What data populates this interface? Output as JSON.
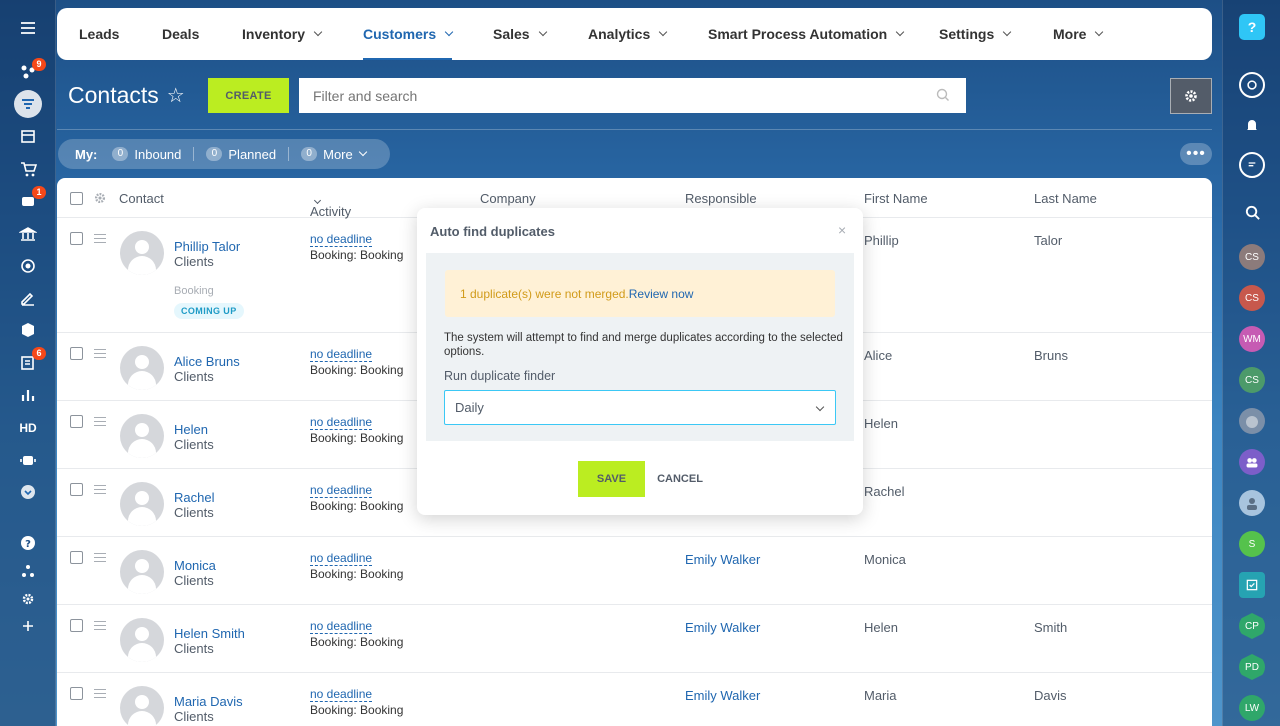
{
  "nav": {
    "items": [
      {
        "label": "Leads",
        "chev": false
      },
      {
        "label": "Deals",
        "chev": false
      },
      {
        "label": "Inventory",
        "chev": true
      },
      {
        "label": "Customers",
        "chev": true
      },
      {
        "label": "Sales",
        "chev": true
      },
      {
        "label": "Analytics",
        "chev": true
      },
      {
        "label": "Smart Process Automation",
        "chev": true
      },
      {
        "label": "Settings",
        "chev": true
      },
      {
        "label": "More",
        "chev": true
      }
    ],
    "active": "Customers"
  },
  "page": {
    "title": "Contacts",
    "create_label": "CREATE",
    "search_placeholder": "Filter and search"
  },
  "filters": {
    "my": "My:",
    "inbound_count": "0",
    "inbound": "Inbound",
    "planned_count": "0",
    "planned": "Planned",
    "more_count": "0",
    "more": "More",
    "dots": "•••"
  },
  "left_sidebar": {
    "badges": {
      "counter_1": "9",
      "counter_2": "1",
      "counter_3": "6"
    },
    "hd_label": "HD"
  },
  "right_sidebar": {
    "avatars": [
      "CS",
      "CS",
      "WM",
      "CS",
      "S",
      "CP",
      "PD",
      "LW"
    ]
  },
  "columns": {
    "contact": "Contact",
    "activity": "Activity",
    "company": "Company",
    "responsible": "Responsible",
    "first_name": "First Name",
    "last_name": "Last Name"
  },
  "rows": [
    {
      "name": "Phillip Talor",
      "type": "Clients",
      "activity_link": "no deadline",
      "activity": "Booking: Booking",
      "responsible": "",
      "first": "Phillip",
      "last": "Talor",
      "booking_label": "Booking",
      "badge": "COMING UP"
    },
    {
      "name": "Alice Bruns",
      "type": "Clients",
      "activity_link": "no deadline",
      "activity": "Booking: Booking",
      "responsible": "",
      "first": "Alice",
      "last": "Bruns"
    },
    {
      "name": "Helen",
      "type": "Clients",
      "activity_link": "no deadline",
      "activity": "Booking: Booking",
      "responsible": "",
      "first": "Helen",
      "last": ""
    },
    {
      "name": "Rachel",
      "type": "Clients",
      "activity_link": "no deadline",
      "activity": "Booking: Booking",
      "responsible": "",
      "first": "Rachel",
      "last": ""
    },
    {
      "name": "Monica",
      "type": "Clients",
      "activity_link": "no deadline",
      "activity": "Booking: Booking",
      "responsible": "Emily Walker",
      "first": "Monica",
      "last": ""
    },
    {
      "name": "Helen Smith",
      "type": "Clients",
      "activity_link": "no deadline",
      "activity": "Booking: Booking",
      "responsible": "Emily Walker",
      "first": "Helen",
      "last": "Smith"
    },
    {
      "name": "Maria Davis",
      "type": "Clients",
      "activity_link": "no deadline",
      "activity": "Booking: Booking",
      "responsible": "Emily Walker",
      "first": "Maria",
      "last": "Davis"
    }
  ],
  "modal": {
    "title": "Auto find duplicates",
    "close": "×",
    "warning": "1 duplicate(s) were not merged.",
    "review_link": "Review now",
    "description": "The system will attempt to find and merge duplicates according to the selected options.",
    "run_label": "Run duplicate finder",
    "selected": "Daily",
    "save": "SAVE",
    "cancel": "CANCEL"
  }
}
